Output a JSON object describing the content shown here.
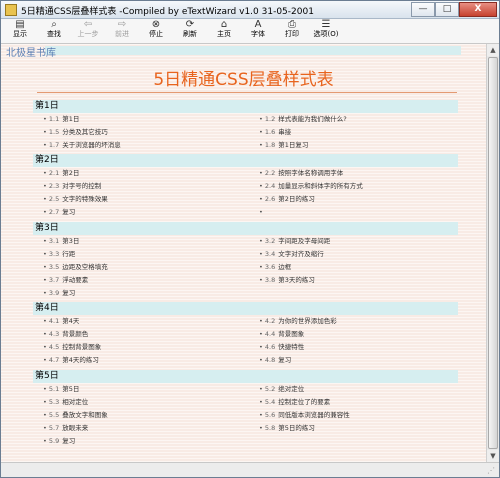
{
  "window": {
    "title": "5日精通CSS层叠样式表  -Compiled by eTextWizard v1.0  31-05-2001",
    "minimize": "—",
    "maximize": "□",
    "close": "X"
  },
  "toolbar": [
    {
      "label": "显示",
      "icon": "display-icon",
      "glyph": "▤",
      "disabled": false
    },
    {
      "label": "查找",
      "icon": "find-icon",
      "glyph": "⌕",
      "disabled": false
    },
    {
      "label": "上一步",
      "icon": "back-icon",
      "glyph": "⇦",
      "disabled": true
    },
    {
      "label": "前进",
      "icon": "forward-icon",
      "glyph": "⇨",
      "disabled": true
    },
    {
      "label": "停止",
      "icon": "stop-icon",
      "glyph": "⊗",
      "disabled": false
    },
    {
      "label": "刷新",
      "icon": "refresh-icon",
      "glyph": "⟳",
      "disabled": false
    },
    {
      "label": "主页",
      "icon": "home-icon",
      "glyph": "⌂",
      "disabled": false
    },
    {
      "label": "字体",
      "icon": "font-icon",
      "glyph": "A",
      "disabled": false
    },
    {
      "label": "打印",
      "icon": "print-icon",
      "glyph": "⎙",
      "disabled": false
    },
    {
      "label": "选项(O)",
      "icon": "options-icon",
      "glyph": "☰",
      "disabled": false
    }
  ],
  "brand": "北极星书库",
  "page_title": "5日精通CSS层叠样式表",
  "days": [
    {
      "label": "第1日",
      "items": [
        {
          "num": "1.1",
          "text": "第1日"
        },
        {
          "num": "1.2",
          "text": "样式表能为我们做什么?"
        },
        {
          "num": "1.5",
          "text": "分类及其它技巧"
        },
        {
          "num": "1.6",
          "text": "串接"
        },
        {
          "num": "1.7",
          "text": "关于浏览器的坏消息"
        },
        {
          "num": "1.8",
          "text": "第1日复习"
        }
      ]
    },
    {
      "label": "第2日",
      "items": [
        {
          "num": "2.1",
          "text": "第2日"
        },
        {
          "num": "2.2",
          "text": "按照字体名称调用字体"
        },
        {
          "num": "2.3",
          "text": "对字号的控制"
        },
        {
          "num": "2.4",
          "text": "加量显示和斜体字的所有方式"
        },
        {
          "num": "2.5",
          "text": "文字的特殊效果"
        },
        {
          "num": "2.6",
          "text": "第2日的练习"
        },
        {
          "num": "2.7",
          "text": "复习"
        },
        {
          "num": "",
          "text": ""
        }
      ]
    },
    {
      "label": "第3日",
      "items": [
        {
          "num": "3.1",
          "text": "第3日"
        },
        {
          "num": "3.2",
          "text": "字间距及字母间距"
        },
        {
          "num": "3.3",
          "text": "行距"
        },
        {
          "num": "3.4",
          "text": "文字对齐及缩行"
        },
        {
          "num": "3.5",
          "text": "边距及空格填充"
        },
        {
          "num": "3.6",
          "text": "边框"
        },
        {
          "num": "3.7",
          "text": "浮动要素"
        },
        {
          "num": "3.8",
          "text": "第3天的练习"
        },
        {
          "num": "3.9",
          "text": "复习"
        }
      ]
    },
    {
      "label": "第4日",
      "items": [
        {
          "num": "4.1",
          "text": "第4天"
        },
        {
          "num": "4.2",
          "text": "为你的世界添加色彩"
        },
        {
          "num": "4.3",
          "text": "背景颜色"
        },
        {
          "num": "4.4",
          "text": "背景图象"
        },
        {
          "num": "4.5",
          "text": "控制背景图象"
        },
        {
          "num": "4.6",
          "text": "快捷特性"
        },
        {
          "num": "4.7",
          "text": "第4天的练习"
        },
        {
          "num": "4.8",
          "text": "复习"
        }
      ]
    },
    {
      "label": "第5日",
      "items": [
        {
          "num": "5.1",
          "text": "第5日"
        },
        {
          "num": "5.2",
          "text": "绝对定位"
        },
        {
          "num": "5.3",
          "text": "相对定位"
        },
        {
          "num": "5.4",
          "text": "控制定位了的要素"
        },
        {
          "num": "5.5",
          "text": "叠放文字和图象"
        },
        {
          "num": "5.6",
          "text": "同低版本浏览器的兼容性"
        },
        {
          "num": "5.7",
          "text": "放眼未来"
        },
        {
          "num": "5.8",
          "text": "第5日的练习"
        },
        {
          "num": "5.9",
          "text": "复习"
        }
      ]
    }
  ],
  "scrollbar": {
    "up": "▲",
    "down": "▼"
  },
  "colors": {
    "title": "#e8641e",
    "band": "#d6eef0",
    "brand": "#5a7fb4"
  }
}
